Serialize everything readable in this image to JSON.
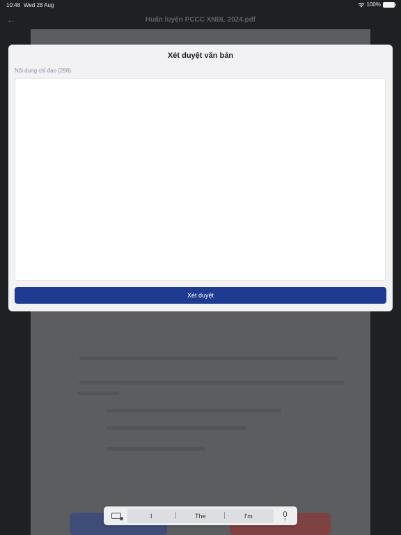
{
  "status_bar": {
    "time": "10:48",
    "date": "Wed 28 Aug",
    "battery": "100%"
  },
  "document": {
    "title": "Huấn luyện PCCC XNĐL 2024.pdf"
  },
  "modal": {
    "title": "Xét duyệt văn bản",
    "field_label": "Nội dung chỉ đạo (298):",
    "field_value": "",
    "submit_label": "Xét duyệt"
  },
  "keyboard_bar": {
    "suggestions": [
      "I",
      "The",
      "I'm"
    ]
  },
  "colors": {
    "primary": "#1f3b91",
    "modal_bg": "#f2f2f4",
    "backdrop": "#1e2024"
  }
}
